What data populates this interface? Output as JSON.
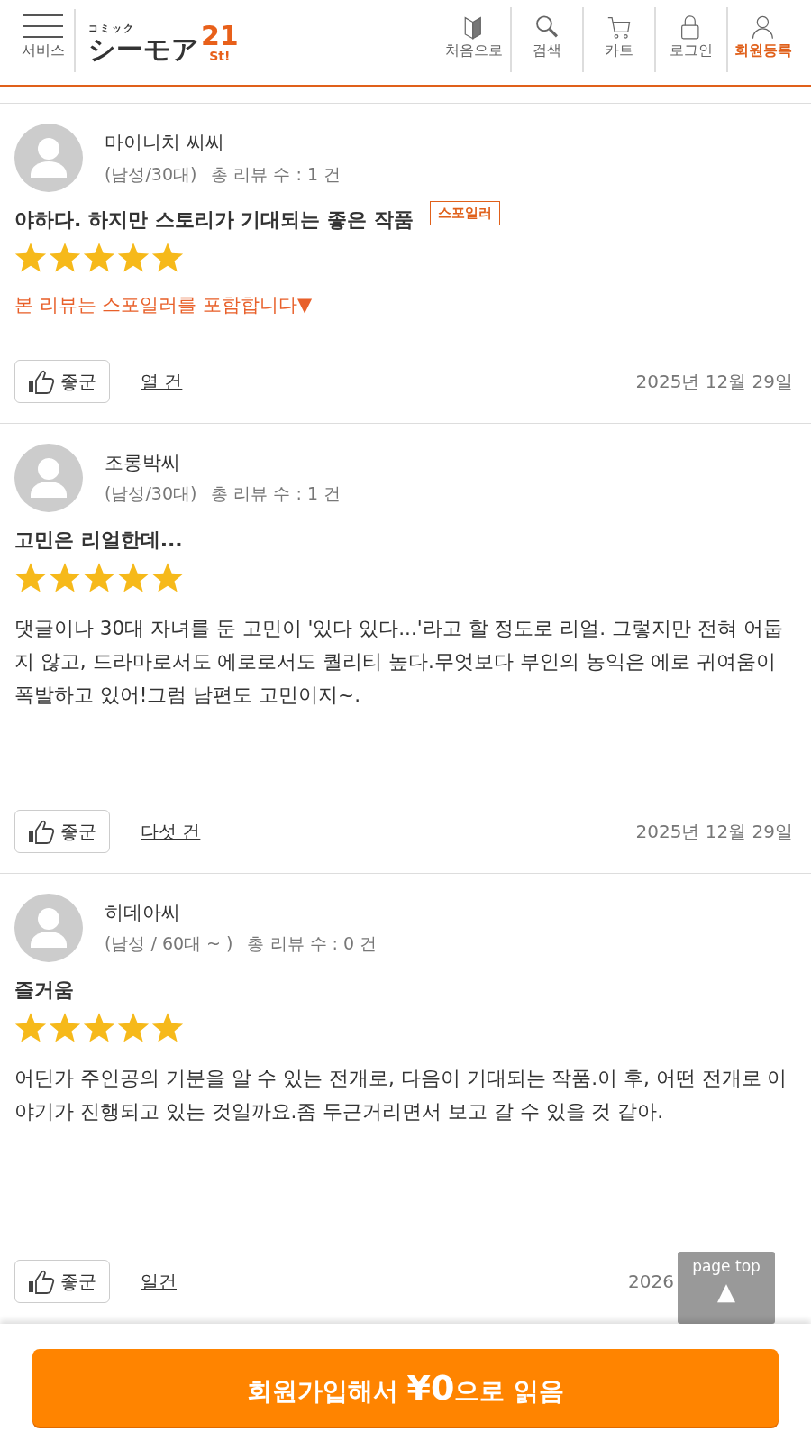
{
  "header": {
    "menu_label": "서비스",
    "logo": {
      "small": "コミック",
      "main": "シーモア",
      "num": "21",
      "sub": "St!"
    },
    "nav": [
      {
        "label": "처음으로",
        "selected": false
      },
      {
        "label": "검색",
        "selected": false
      },
      {
        "label": "카트",
        "selected": false
      },
      {
        "label": "로그인",
        "selected": false
      },
      {
        "label": "회원등록",
        "selected": true
      }
    ]
  },
  "reviews": [
    {
      "name": "마이니치 씨씨",
      "meta": "(남성/30대)",
      "count": "총 리뷰 수 : 1 건",
      "title": "야하다. 하지만 스토리가 기대되는 좋은 작품",
      "spoiler_tag": "스포일러",
      "stars": 5,
      "spoiler_notice": "본 리뷰는 스포일러를 포함합니다▼",
      "like": "좋군",
      "likes": "열 건",
      "date": "2025년 12월 29일"
    },
    {
      "name": "조롱박씨",
      "meta": "(남성/30대)",
      "count": "총 리뷰 수 : 1 건",
      "title": "고민은 리얼한데...",
      "stars": 5,
      "body": "댓글이나 30대 자녀를 둔 고민이 '있다 있다...'라고 할 정도로 리얼. 그렇지만 전혀 어둡지 않고, 드라마로서도 에로로서도 퀄리티 높다.무엇보다 부인의 농익은 에로 귀여움이 폭발하고 있어!그럼 남편도 고민이지~.",
      "like": "좋군",
      "likes": "다섯 건",
      "date": "2025년 12월 29일"
    },
    {
      "name": "히데아씨",
      "meta": "(남성 / 60대 ~ )",
      "count": "총 리뷰 수 : 0 건",
      "title": "즐거움",
      "stars": 5,
      "body": "어딘가 주인공의 기분을 알 수 있는 전개로, 다음이 기대되는 작품.이 후, 어떤 전개로 이야기가 진행되고 있는 것일까요.좀 두근거리면서 보고 갈 수 있을 것 같아.",
      "like": "좋군",
      "likes": "일건",
      "date": "2026"
    }
  ],
  "page_top": {
    "label": "page top",
    "arrow": "▲"
  },
  "cta": {
    "before": "회원가입해서 ",
    "price": "¥0",
    "after": "으로 읽음"
  }
}
